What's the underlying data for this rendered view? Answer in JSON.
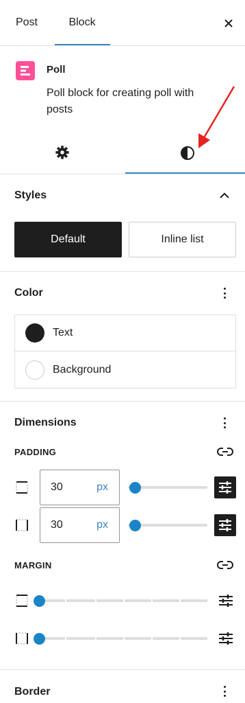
{
  "tabs": [
    {
      "label": "Post",
      "active": false
    },
    {
      "label": "Block",
      "active": true
    }
  ],
  "block": {
    "name": "Poll",
    "description": "Poll block for creating poll with posts",
    "icon": "poll-list-icon",
    "icon_color": "#ff4f97"
  },
  "inspector_tabs": [
    {
      "icon": "gear-icon",
      "active": false
    },
    {
      "icon": "contrast-icon",
      "active": true
    }
  ],
  "annotation": {
    "arrow_color": "#e52421"
  },
  "styles": {
    "title": "Styles",
    "options": [
      {
        "label": "Default",
        "selected": true
      },
      {
        "label": "Inline list",
        "selected": false
      }
    ]
  },
  "color": {
    "title": "Color",
    "items": [
      {
        "label": "Text",
        "swatch": "#1e1e1e"
      },
      {
        "label": "Background",
        "swatch": "#ffffff"
      }
    ]
  },
  "dimensions": {
    "title": "Dimensions",
    "padding": {
      "label": "PADDING",
      "rows": [
        {
          "value": "30",
          "unit": "px"
        },
        {
          "value": "30",
          "unit": "px"
        }
      ]
    },
    "margin": {
      "label": "MARGIN"
    }
  },
  "border": {
    "title": "Border"
  },
  "colors": {
    "accent": "#3c86c4",
    "slider": "#1b84c7",
    "dark": "#1e1e1e"
  }
}
